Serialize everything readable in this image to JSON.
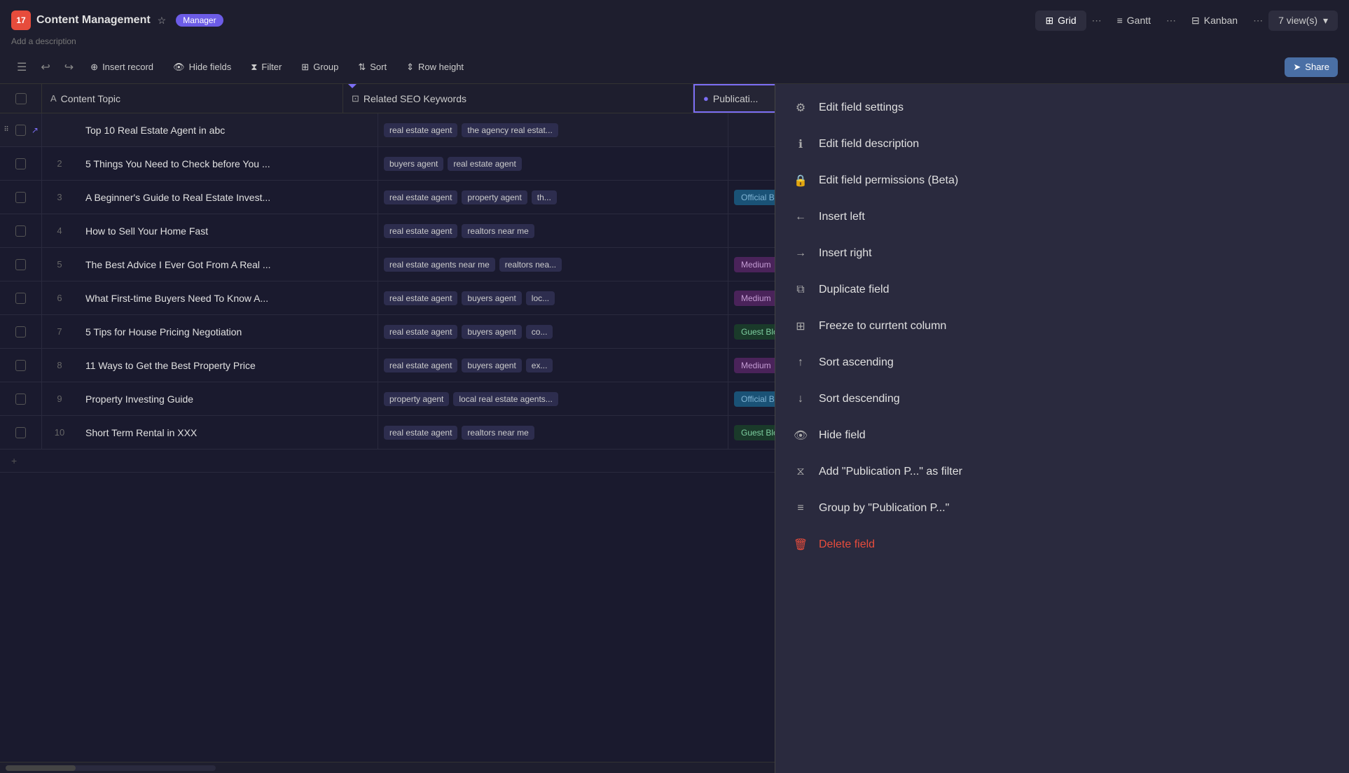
{
  "app": {
    "icon": "17",
    "title": "Content Management",
    "description": "Add a description",
    "badge": "Manager"
  },
  "views": {
    "grid": "Grid",
    "gantt": "Gantt",
    "kanban": "Kanban",
    "count_label": "7 view(s)"
  },
  "toolbar": {
    "insert_record": "Insert record",
    "hide_fields": "Hide fields",
    "filter": "Filter",
    "group": "Group",
    "sort": "Sort",
    "row_height": "Row height",
    "share": "Share"
  },
  "table": {
    "columns": {
      "topic": "Content Topic",
      "keywords": "Related SEO Keywords",
      "publication": "Publicati..."
    },
    "rows": [
      {
        "num": "",
        "topic": "Top 10 Real Estate Agent in abc",
        "keywords": [
          "real estate agent",
          "the agency real estat..."
        ],
        "publication": ""
      },
      {
        "num": "2",
        "topic": "5 Things You Need to Check before You ...",
        "keywords": [
          "buyers agent",
          "real estate agent"
        ],
        "publication": ""
      },
      {
        "num": "3",
        "topic": "A Beginner's Guide to Real Estate Invest...",
        "keywords": [
          "real estate agent",
          "property agent",
          "th..."
        ],
        "publication": "Official Blog"
      },
      {
        "num": "4",
        "topic": "How to Sell Your Home Fast",
        "keywords": [
          "real estate agent",
          "realtors near me"
        ],
        "publication": ""
      },
      {
        "num": "5",
        "topic": "The Best Advice I Ever Got From A Real ...",
        "keywords": [
          "real estate agents near me",
          "realtors nea..."
        ],
        "publication": "Medium"
      },
      {
        "num": "6",
        "topic": "What First-time Buyers Need To Know A...",
        "keywords": [
          "real estate agent",
          "buyers agent",
          "loc..."
        ],
        "publication": "Medium"
      },
      {
        "num": "7",
        "topic": "5 Tips for House Pricing Negotiation",
        "keywords": [
          "real estate agent",
          "buyers agent",
          "co..."
        ],
        "publication": "Guest Blog"
      },
      {
        "num": "8",
        "topic": "11 Ways to Get the Best Property Price",
        "keywords": [
          "real estate agent",
          "buyers agent",
          "ex..."
        ],
        "publication": "Medium"
      },
      {
        "num": "9",
        "topic": "Property Investing Guide",
        "keywords": [
          "property agent",
          "local real estate agents..."
        ],
        "publication": "Official Blog"
      },
      {
        "num": "10",
        "topic": "Short Term Rental in XXX",
        "keywords": [
          "real estate agent",
          "realtors near me"
        ],
        "publication": "Guest Blog"
      }
    ]
  },
  "context_menu": {
    "items": [
      {
        "id": "edit-field-settings",
        "icon": "⚙",
        "label": "Edit field settings"
      },
      {
        "id": "edit-field-description",
        "icon": "ℹ",
        "label": "Edit field description"
      },
      {
        "id": "edit-field-permissions",
        "icon": "🔒",
        "label": "Edit field permissions (Beta)"
      },
      {
        "id": "insert-left",
        "icon": "←",
        "label": "Insert left"
      },
      {
        "id": "insert-right",
        "icon": "→",
        "label": "Insert right"
      },
      {
        "id": "duplicate-field",
        "icon": "⧉",
        "label": "Duplicate field"
      },
      {
        "id": "freeze-column",
        "icon": "⊞",
        "label": "Freeze to currtent column"
      },
      {
        "id": "sort-ascending",
        "icon": "↑",
        "label": "Sort ascending"
      },
      {
        "id": "sort-descending",
        "icon": "↓",
        "label": "Sort descending"
      },
      {
        "id": "hide-field",
        "icon": "👁",
        "label": "Hide field"
      },
      {
        "id": "add-filter",
        "icon": "⧖",
        "label": "Add \"Publication P...\" as filter"
      },
      {
        "id": "group-by",
        "icon": "≡",
        "label": "Group by \"Publication P...\""
      },
      {
        "id": "delete-field",
        "icon": "🗑",
        "label": "Delete field"
      }
    ]
  }
}
